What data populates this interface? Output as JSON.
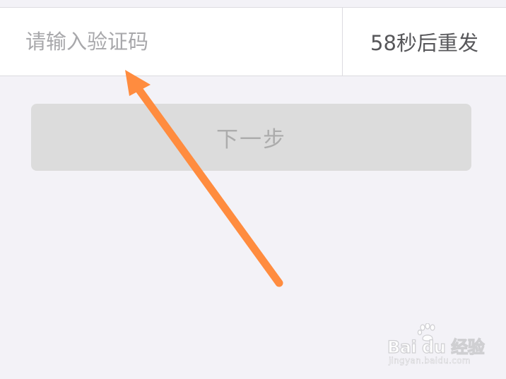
{
  "verification": {
    "placeholder": "请输入验证码",
    "value": "",
    "resend_label": "58秒后重发"
  },
  "next_button": {
    "label": "下一步",
    "enabled": false
  },
  "annotation": {
    "icon": "arrow-icon",
    "color": "#ff8c3f",
    "points_to": "code-input"
  },
  "watermark": {
    "brand": "Bai du 经验",
    "url": "jingyan.baidu.com"
  },
  "colors": {
    "background": "#f3f2f7",
    "row_background": "#ffffff",
    "button_disabled": "#dcdcdc",
    "button_text_disabled": "#acacac",
    "placeholder_text": "#a8a8ab",
    "resend_text": "#57575a"
  }
}
